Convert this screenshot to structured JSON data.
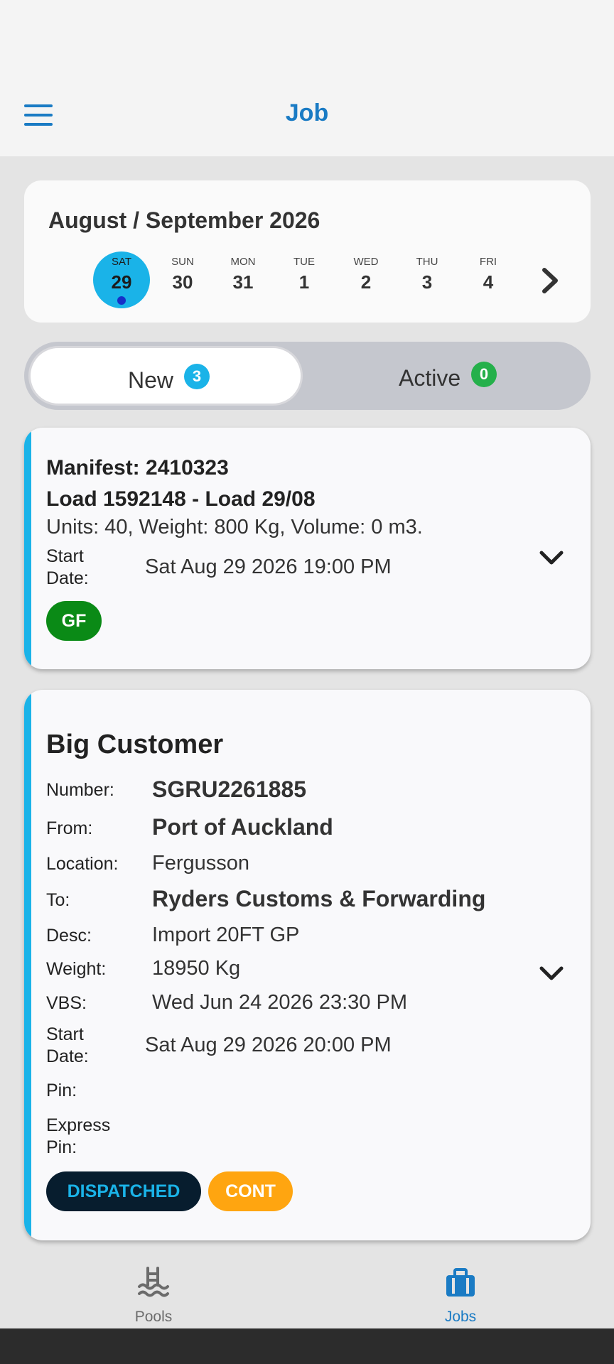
{
  "header": {
    "title": "Job",
    "accent_color": "#1a7bc4",
    "menu_icon": "hamburger-menu-icon"
  },
  "calendar": {
    "month_label": "August / September 2026",
    "days": [
      {
        "name": "SAT",
        "num": "29",
        "selected": true
      },
      {
        "name": "SUN",
        "num": "30"
      },
      {
        "name": "MON",
        "num": "31"
      },
      {
        "name": "TUE",
        "num": "1"
      },
      {
        "name": "WED",
        "num": "2"
      },
      {
        "name": "THU",
        "num": "3"
      },
      {
        "name": "FRI",
        "num": "4"
      }
    ],
    "selected_color": "#1ab3e8",
    "next_icon": "chevron-right-icon"
  },
  "tabs": {
    "new": {
      "label": "New",
      "count": "3",
      "badge_color": "#1ab3e8"
    },
    "active": {
      "label": "Active",
      "count": "0",
      "badge_color": "#25b04b"
    }
  },
  "jobs": [
    {
      "manifest": "Manifest: 2410323",
      "load": "Load 1592148 - Load 29/08",
      "summary": "Units: 40, Weight: 800 Kg, Volume: 0 m3.",
      "start_label_1": "Start",
      "start_label_2": "Date:",
      "start_value": "Sat Aug 29 2026 19:00 PM",
      "tags": [
        {
          "label": "GF",
          "color": "#0a8a16"
        }
      ]
    },
    {
      "customer": "Big Customer",
      "fields": [
        {
          "label": "Number:",
          "value": "SGRU2261885"
        },
        {
          "label": "From:",
          "value": "Port of Auckland"
        },
        {
          "label": "Location:",
          "value": "Fergusson"
        },
        {
          "label": "To:",
          "value": "Ryders Customs & Forwarding"
        },
        {
          "label": "Desc:",
          "value": "Import 20FT GP"
        },
        {
          "label": "Weight:",
          "value": "18950 Kg"
        },
        {
          "label": "VBS:",
          "value": "Wed Jun 24 2026 23:30 PM"
        }
      ],
      "start_label_1": "Start",
      "start_label_2": "Date:",
      "start_value": "Sat Aug 29 2026 20:00 PM",
      "pin_label": "Pin:",
      "express_label_1": "Express",
      "express_label_2": "Pin:",
      "tags": [
        {
          "label": "DISPATCHED",
          "color": "#071d2e",
          "text_color": "#1ab3e8"
        },
        {
          "label": "CONT",
          "color": "#ffa510",
          "text_color": "#ffffff"
        }
      ]
    }
  ],
  "bottom_nav": {
    "pools": {
      "label": "Pools",
      "icon": "swimming-pool-icon",
      "color": "#6b6b6b"
    },
    "jobs": {
      "label": "Jobs",
      "icon": "briefcase-icon",
      "color": "#1a7bc4"
    }
  }
}
